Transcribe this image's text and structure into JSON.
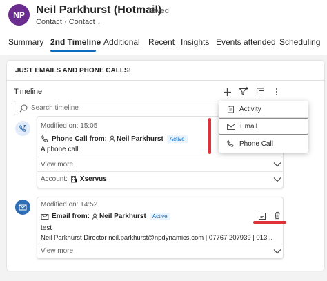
{
  "record": {
    "initials": "NP",
    "title": "Neil Parkhurst (Hotmail)",
    "saved": "- Saved",
    "entity": "Contact",
    "separator": "·",
    "form": "Contact"
  },
  "tabs": [
    {
      "label": "Summary"
    },
    {
      "label": "2nd Timeline"
    },
    {
      "label": "Additional"
    },
    {
      "label": "Recent"
    },
    {
      "label": "Insights"
    },
    {
      "label": "Events attended"
    },
    {
      "label": "Scheduling"
    }
  ],
  "active_tab": "2nd Timeline",
  "section": {
    "title": "JUST EMAILS AND PHONE CALLS!"
  },
  "timeline": {
    "label": "Timeline",
    "search_placeholder": "Search timeline",
    "toolbar_icons": [
      "add-icon",
      "filter-icon",
      "sort-icon",
      "more-icon"
    ]
  },
  "dropdown": {
    "items": [
      {
        "label": "Activity",
        "icon": "activity-icon"
      },
      {
        "label": "Email",
        "icon": "email-icon"
      },
      {
        "label": "Phone Call",
        "icon": "phone-icon"
      }
    ],
    "selected": "Email"
  },
  "records": [
    {
      "type_icon": "phone-call-icon",
      "modified": "Modified on: 15:05",
      "head_type": "Phone Call from:",
      "person": "Neil Parkhurst",
      "badge": "Active",
      "body": "A phone call",
      "view_more": "View more",
      "account_label": "Account:",
      "account_value": "Xservus"
    },
    {
      "type_icon": "email-icon",
      "modified": "Modified on: 14:52",
      "head_type": "Email from:",
      "person": "Neil Parkhurst",
      "badge": "Active",
      "body": "test",
      "body2": "Neil Parkhurst Director neil.parkhurst@npdynamics.com | 07767 207939 | 013...",
      "view_more": "View more"
    }
  ],
  "colors": {
    "accent": "#0f6cbd",
    "avatar": "#6b2c8f",
    "annotation": "#e0313a",
    "badge_bg": "#ebf3fc"
  }
}
